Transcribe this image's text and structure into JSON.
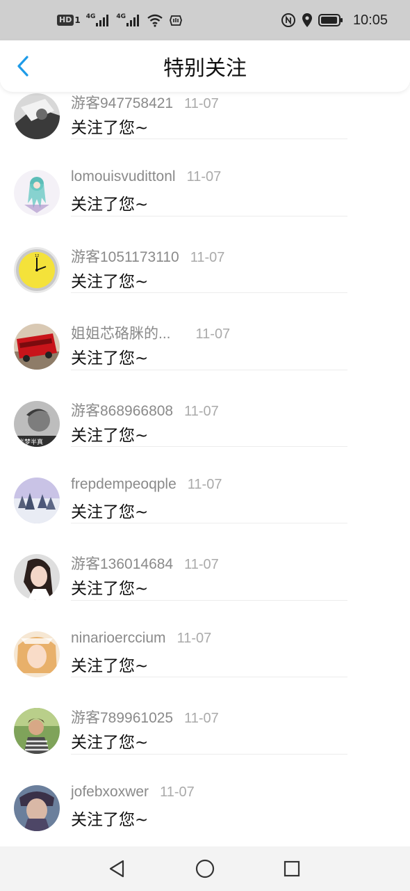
{
  "status_bar": {
    "left_icons": [
      "hd-icon",
      "signal-4g-icon",
      "signal-4g-icon",
      "wifi-icon",
      "hand-icon"
    ],
    "hd_label": "HD",
    "sim1_label": "1",
    "net1_label": "4G",
    "net2_label": "4G",
    "right_icons": [
      "nfc-icon",
      "location-icon",
      "battery-icon"
    ],
    "time": "10:05"
  },
  "header": {
    "back_icon": "chevron-left-icon",
    "title": "特别关注",
    "accent_color": "#1e9be8"
  },
  "list": {
    "items": [
      {
        "name": "游客947758421",
        "date": "11-07",
        "message": "关注了您~",
        "avatar": "avatar-bw-photo"
      },
      {
        "name": "lomouisvudittonl",
        "date": "11-07",
        "message": "关注了您~",
        "avatar": "avatar-anime-girl"
      },
      {
        "name": "游客1051173110",
        "date": "11-07",
        "message": "关注了您~",
        "avatar": "avatar-yellow-clock"
      },
      {
        "name": "姐姐芯硌脒的...",
        "date": "11-07",
        "message": "关注了您~",
        "avatar": "avatar-red-bus"
      },
      {
        "name": "游客868966808",
        "date": "11-07",
        "message": "关注了您~",
        "avatar": "avatar-gray-portrait",
        "avatar_caption": "半梦半真"
      },
      {
        "name": "frepdempeoqple",
        "date": "11-07",
        "message": "关注了您~",
        "avatar": "avatar-snow-forest"
      },
      {
        "name": "游客136014684",
        "date": "11-07",
        "message": "关注了您~",
        "avatar": "avatar-girl-selfie"
      },
      {
        "name": "ninarioerccium",
        "date": "11-07",
        "message": "关注了您~",
        "avatar": "avatar-blonde-girl"
      },
      {
        "name": "游客789961025",
        "date": "11-07",
        "message": "关注了您~",
        "avatar": "avatar-child-outdoors"
      },
      {
        "name": "jofebxoxwer",
        "date": "11-07",
        "message": "关注了您~",
        "avatar": "avatar-boy-portrait"
      }
    ]
  },
  "nav_bar": {
    "back_icon": "triangle-back-icon",
    "home_icon": "circle-home-icon",
    "recents_icon": "square-recents-icon"
  }
}
